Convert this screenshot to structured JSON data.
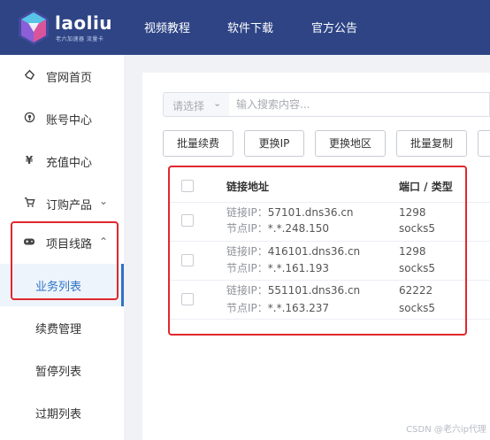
{
  "brand": {
    "name": "laoliu",
    "tagline": "老六加速器 流量卡"
  },
  "nav": [
    "视频教程",
    "软件下载",
    "官方公告"
  ],
  "sidebar": {
    "items": [
      {
        "label": "官网首页",
        "icon": "home-icon"
      },
      {
        "label": "账号中心",
        "icon": "user-icon"
      },
      {
        "label": "充值中心",
        "icon": "yen-icon"
      },
      {
        "label": "订购产品",
        "icon": "cart-icon"
      },
      {
        "label": "项目线路",
        "icon": "gamepad-icon"
      }
    ],
    "sub_items": [
      "业务列表",
      "续费管理",
      "暂停列表",
      "过期列表"
    ]
  },
  "search": {
    "select_placeholder": "请选择",
    "input_placeholder": "输入搜索内容..."
  },
  "toolbar": {
    "renew": "批量续费",
    "change_ip": "更换IP",
    "change_region": "更换地区",
    "copy": "批量复制"
  },
  "table": {
    "headers": {
      "address": "链接地址",
      "port_type": "端口 / 类型"
    },
    "rows": [
      {
        "link_label": "链接IP：",
        "link": "57101.dns36.cn",
        "node_label": "节点IP：",
        "node": "*.*.248.150",
        "port": "1298",
        "type": "socks5"
      },
      {
        "link_label": "链接IP：",
        "link": "416101.dns36.cn",
        "node_label": "节点IP：",
        "node": "*.*.161.193",
        "port": "1298",
        "type": "socks5"
      },
      {
        "link_label": "链接IP：",
        "link": "551101.dns36.cn",
        "node_label": "节点IP：",
        "node": "*.*.163.237",
        "port": "62222",
        "type": "socks5"
      }
    ]
  },
  "watermark": "CSDN @老六ip代理",
  "colors": {
    "header": "#2e4485",
    "accent": "#2d73c7",
    "highlight": "#e0282e"
  }
}
